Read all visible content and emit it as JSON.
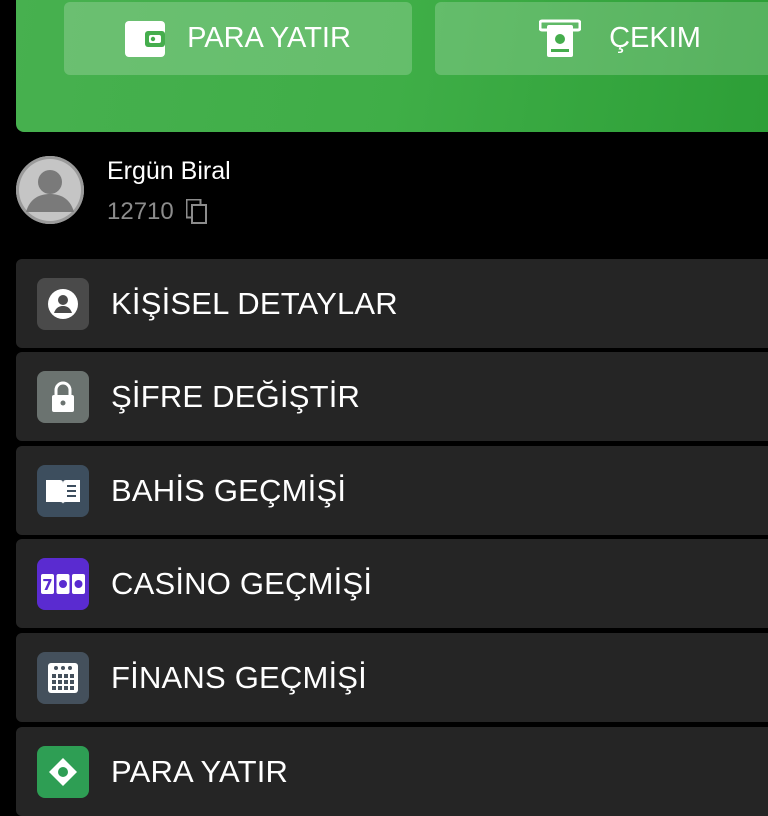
{
  "wallet": {
    "deposit_label": "PARA YATIR",
    "withdraw_label": "ÇEKIM",
    "colors": {
      "card": "#3fae47",
      "button_overlay": "rgba(255,255,255,0.2)"
    }
  },
  "user": {
    "name": "Ergün Biral",
    "id": "12710"
  },
  "menu": {
    "items": [
      {
        "label": "KİŞİSEL DETAYLAR",
        "icon": "person-icon",
        "icon_color": "#4a4a4a"
      },
      {
        "label": "ŞİFRE DEĞİŞTİR",
        "icon": "lock-icon",
        "icon_color": "#6b7370"
      },
      {
        "label": "BAHİS GEÇMİŞİ",
        "icon": "book-icon",
        "icon_color": "#3d4e5e"
      },
      {
        "label": "CASİNO GEÇMİŞİ",
        "icon": "slot-machine-icon",
        "icon_color": "#5a2bd0"
      },
      {
        "label": "FİNANS GEÇMİŞİ",
        "icon": "calendar-grid-icon",
        "icon_color": "#44505c"
      },
      {
        "label": "PARA YATIR",
        "icon": "deposit-icon",
        "icon_color": "#2e9e54"
      }
    ]
  }
}
